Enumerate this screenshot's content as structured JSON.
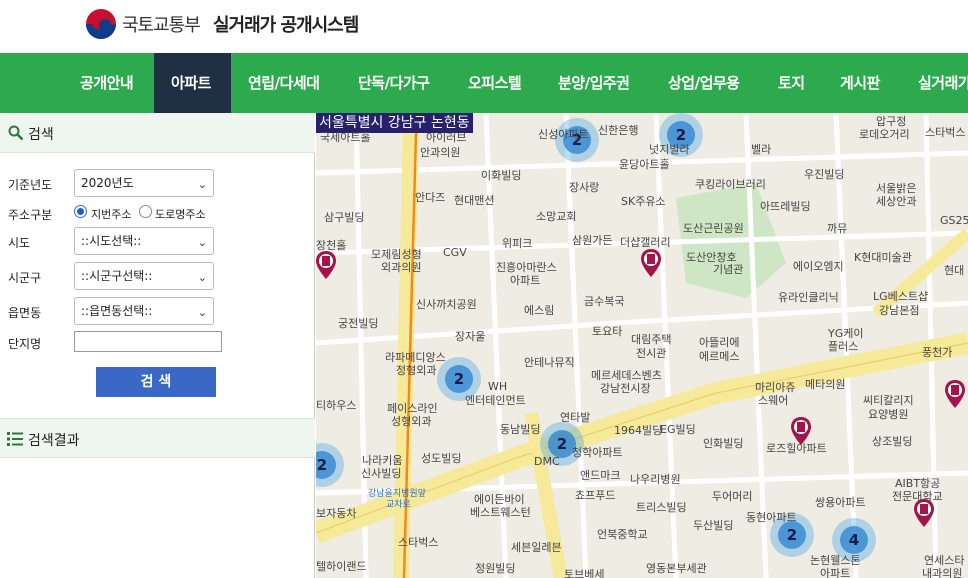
{
  "header": {
    "ministry": "국토교통부",
    "system": "실거래가 공개시스템"
  },
  "nav": {
    "items": [
      "공개안내",
      "아파트",
      "연립/다세대",
      "단독/다가구",
      "오피스텔",
      "분양/입주권",
      "상업/업무용",
      "토지",
      "게시판",
      "실거래가"
    ],
    "active": "아파트"
  },
  "search": {
    "title": "검색",
    "year_label": "기준년도",
    "year_value": "2020년도",
    "addr_type_label": "주소구분",
    "addr_option_lot": "지번주소",
    "addr_option_road": "도로명주소",
    "sido_label": "시도",
    "sido_value": "::시도선택::",
    "sigungu_label": "시군구",
    "sigungu_value": "::시군구선택::",
    "dong_label": "읍면동",
    "dong_value": "::읍면동선택::",
    "complex_label": "단지명",
    "complex_value": "",
    "button": "검 색"
  },
  "results": {
    "title": "검색결과"
  },
  "map": {
    "region": "서울특별시 강남구 논현동",
    "clusters": [
      "2",
      "2",
      "2",
      "2",
      "2",
      "2",
      "4"
    ],
    "labels": [
      "국세아트홀",
      "아이러브",
      "안과의원",
      "이화빌딩",
      "신성아파트",
      "신한은행",
      "넛지빌라",
      "벨라",
      "압구정",
      "로데오거리",
      "스타벅스",
      "윤당아트홀",
      "쿠킹라이브러리",
      "우진빌딩",
      "서울밝은",
      "세상안과",
      "안다즈",
      "현대맨션",
      "장사랑",
      "SK주유소",
      "아뜨레빌딩",
      "삼구빌딩",
      "소망교회",
      "삼원가든",
      "더샵갤러리",
      "도산근린공원",
      "까뮤",
      "GS25",
      "장천홀",
      "모제림성형",
      "외과의원",
      "CGV",
      "위피크",
      "진흥아마란스",
      "아파트",
      "도산안창호",
      "기념관",
      "에이오엠지",
      "K현대미술관",
      "현대",
      "신사까치공원",
      "에스림",
      "금수복국",
      "유라인클리닉",
      "LG베스트샵",
      "강남본점",
      "궁전빌딩",
      "장자울",
      "토요타",
      "대림주택",
      "전시관",
      "아뜰리에",
      "에르메스",
      "YG케이",
      "플러스",
      "풍천가",
      "라파메디앙스",
      "정형외과",
      "안테나뮤직",
      "메르세데스벤츠",
      "강남전시장",
      "마리아쥬",
      "스웨어",
      "메타의원",
      "티하우스",
      "페이스라인",
      "성형외과",
      "WH",
      "엔터테인먼트",
      "연타발",
      "씨티칼리지",
      "요양병원",
      "동남빌딩",
      "1964빌딩",
      "EG빌딩",
      "인화빌딩",
      "로즈힐아파트",
      "상조빌딩",
      "나라키움",
      "신사빌딩",
      "성도빌딩",
      "DMC",
      "청학아파트",
      "앤드마크",
      "나우리병원",
      "AIBT항공",
      "전문대학교",
      "강남을지병원앞",
      "교차로",
      "에이든바이",
      "베스트웨스턴",
      "쵸프푸드",
      "트리스빌딩",
      "두어머리",
      "쌍용아파트",
      "보자동차",
      "동현아파트",
      "두산빌딩",
      "스타벅스",
      "세븐일레븐",
      "언북중학교",
      "논현웰스톤",
      "아파트",
      "연세스타",
      "내과의원",
      "텔하이랜드",
      "정원빌딩",
      "토브베세",
      "영동본부세관"
    ]
  }
}
